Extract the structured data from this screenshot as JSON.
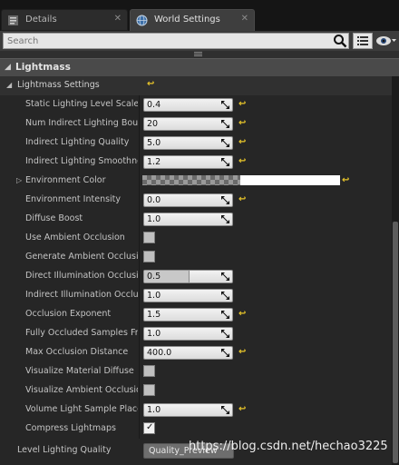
{
  "tabs": [
    {
      "label": "Details",
      "icon": "details-icon",
      "close": "✕"
    },
    {
      "label": "World Settings",
      "icon": "globe-icon",
      "close": "✕"
    }
  ],
  "search": {
    "placeholder": "Search",
    "value": ""
  },
  "section": {
    "title": "Lightmass"
  },
  "lightmass_settings": {
    "label": "Lightmass Settings"
  },
  "properties": [
    {
      "label": "Static Lighting Level Scale",
      "type": "number",
      "value": "0.4",
      "reset": true
    },
    {
      "label": "Num Indirect Lighting Bounces",
      "type": "number",
      "value": "20",
      "reset": true
    },
    {
      "label": "Indirect Lighting Quality",
      "type": "number",
      "value": "5.0",
      "reset": true
    },
    {
      "label": "Indirect Lighting Smoothness",
      "type": "number",
      "value": "1.2",
      "reset": true
    },
    {
      "label": "Environment Color",
      "type": "color",
      "value": "",
      "reset": true
    },
    {
      "label": "Environment Intensity",
      "type": "number",
      "value": "0.0",
      "reset": true
    },
    {
      "label": "Diffuse Boost",
      "type": "number",
      "value": "1.0",
      "reset": false
    },
    {
      "label": "Use Ambient Occlusion",
      "type": "checkbox",
      "checked": false
    },
    {
      "label": "Generate Ambient Occlusion Material Mask",
      "type": "checkbox",
      "checked": false
    },
    {
      "label": "Direct Illumination Occlusion Fraction",
      "type": "slider",
      "value": "0.5",
      "fraction": 0.5,
      "reset": false
    },
    {
      "label": "Indirect Illumination Occlusion Fraction",
      "type": "number",
      "value": "1.0",
      "reset": false
    },
    {
      "label": "Occlusion Exponent",
      "type": "number",
      "value": "1.5",
      "reset": true
    },
    {
      "label": "Fully Occluded Samples Fraction",
      "type": "number",
      "value": "1.0",
      "reset": false
    },
    {
      "label": "Max Occlusion Distance",
      "type": "number",
      "value": "400.0",
      "reset": true
    },
    {
      "label": "Visualize Material Diffuse",
      "type": "checkbox",
      "checked": false
    },
    {
      "label": "Visualize Ambient Occlusion",
      "type": "checkbox",
      "checked": false
    },
    {
      "label": "Volume Light Sample Placement Scale",
      "type": "number",
      "value": "1.0",
      "reset": true
    },
    {
      "label": "Compress Lightmaps",
      "type": "checkbox",
      "checked": true
    }
  ],
  "level_quality": {
    "label": "Level Lighting Quality",
    "value": "Quality_Preview"
  },
  "reset_glyph": "↩",
  "watermark": "https://blog.csdn.net/hechao3225",
  "colors": {
    "reset_arrow": "#e8c52a",
    "background": "#262626",
    "section": "#4a4a4a"
  }
}
